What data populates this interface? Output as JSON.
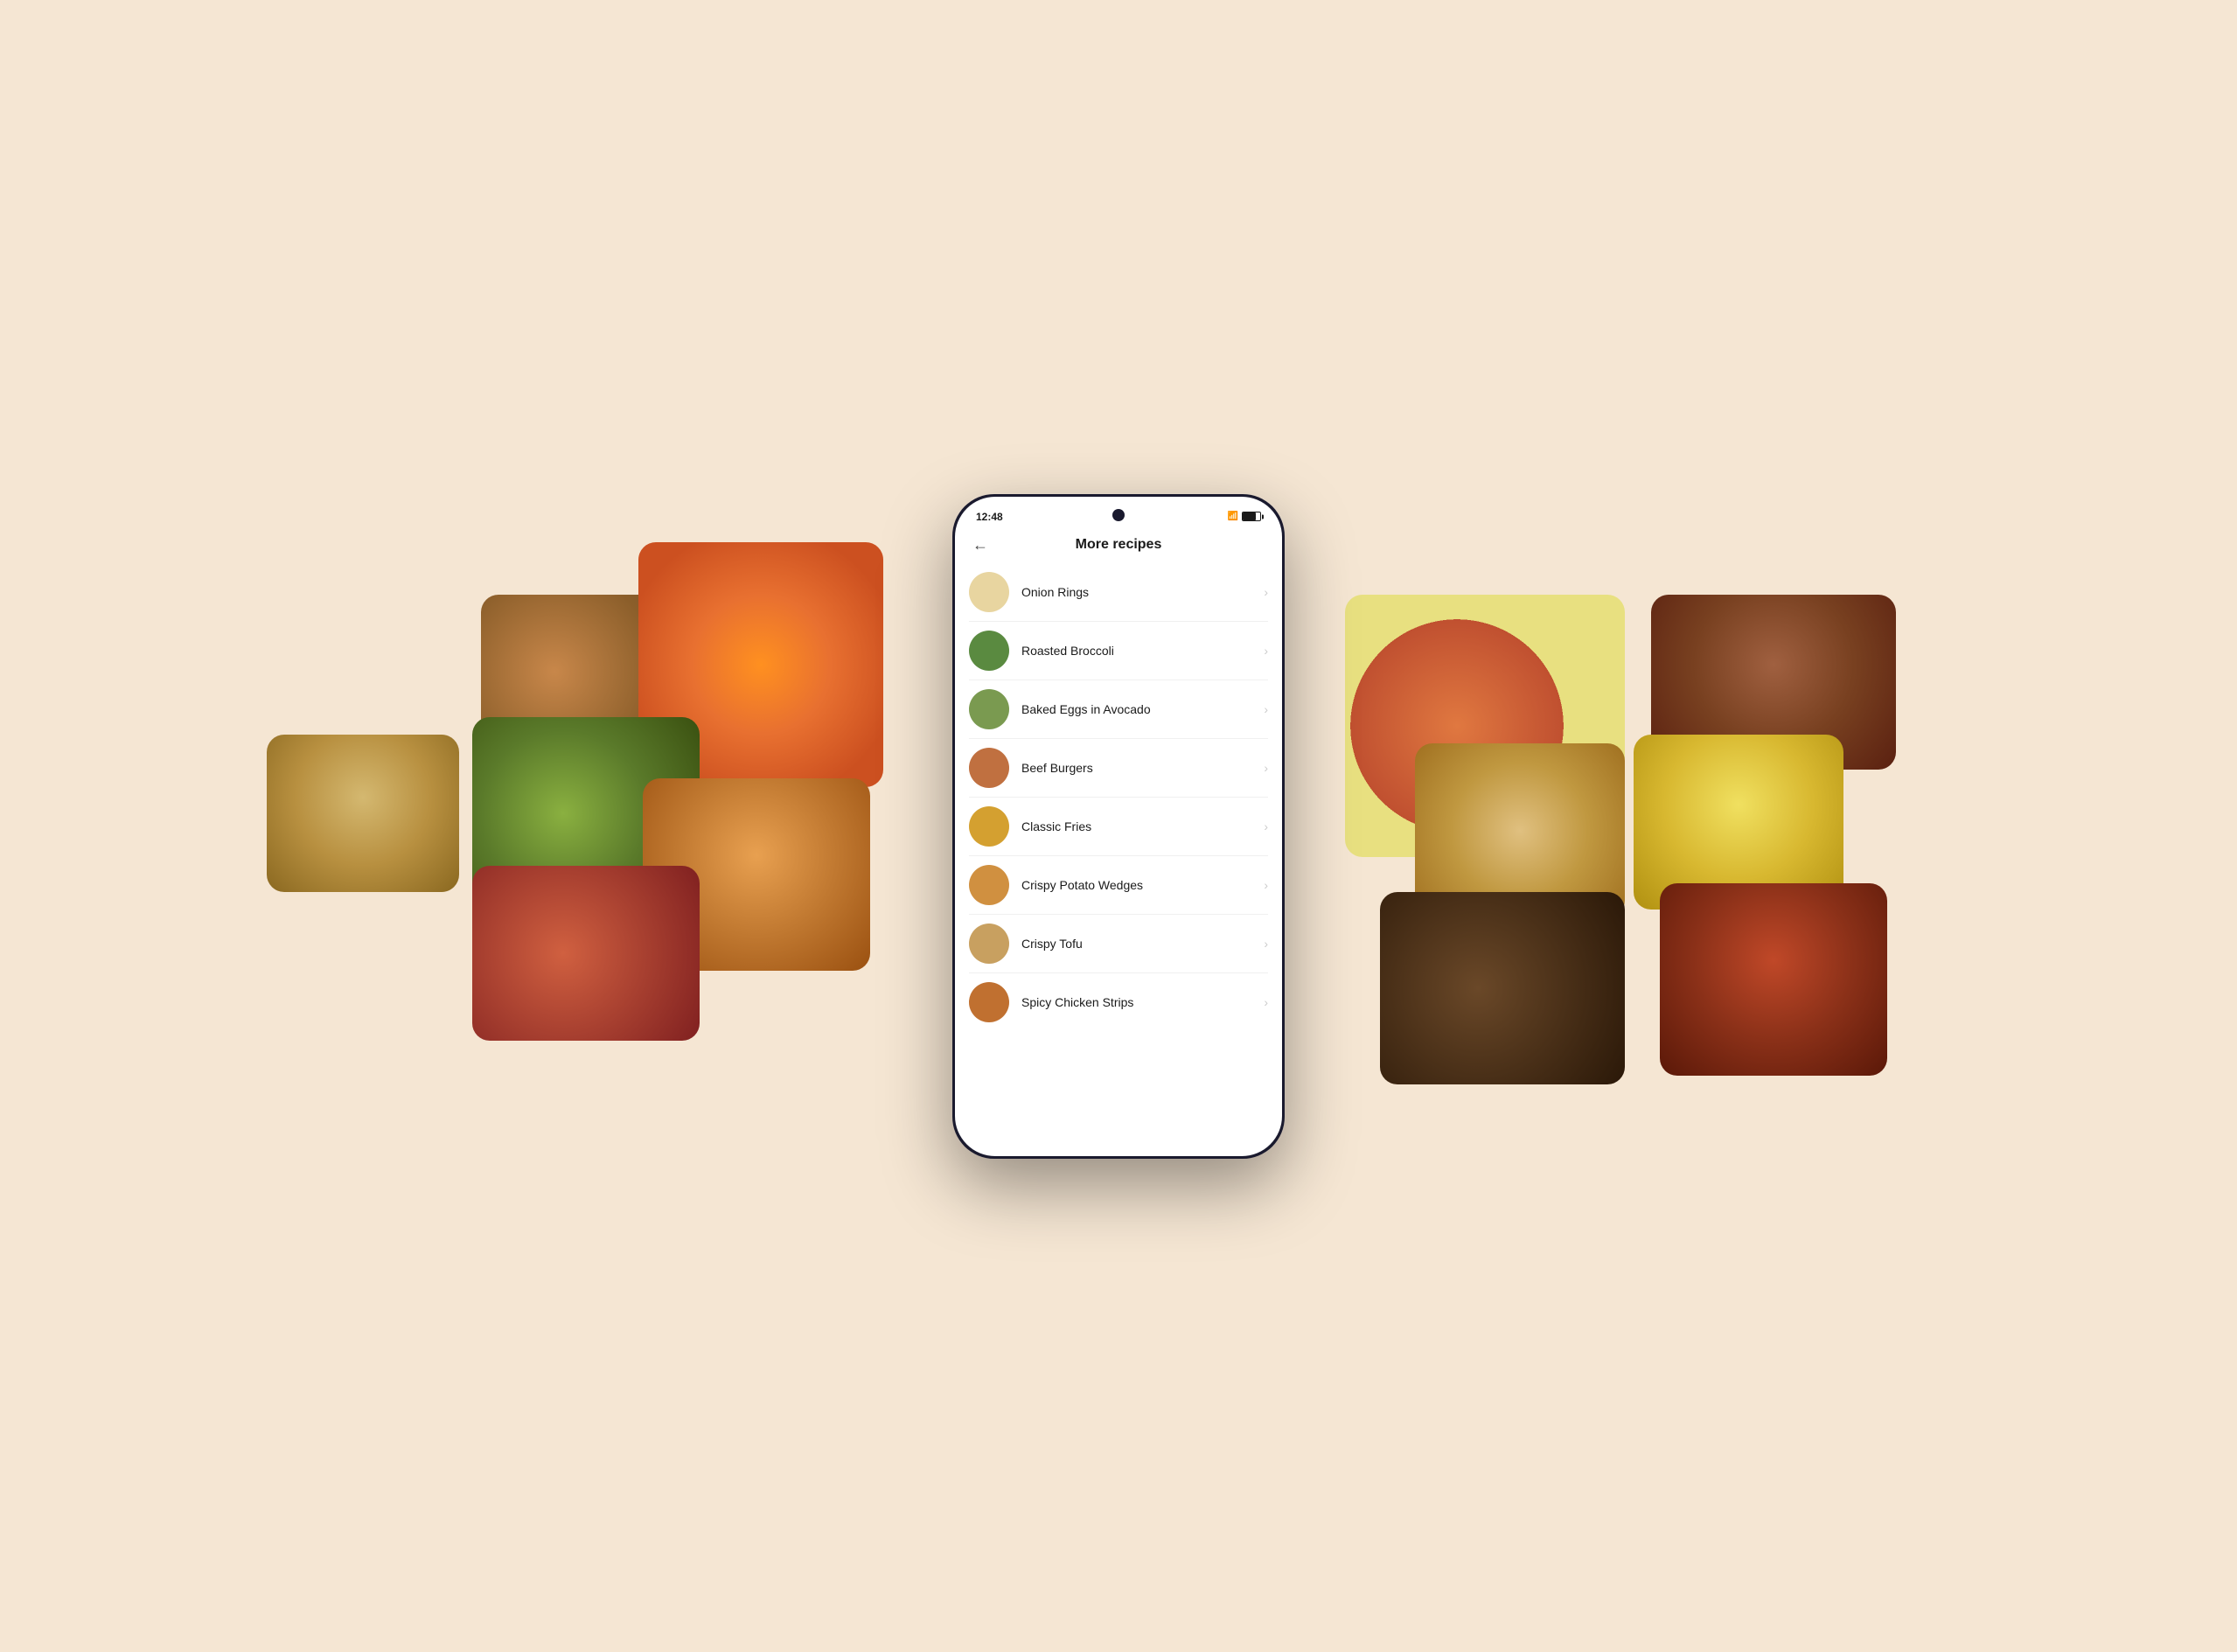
{
  "background": {
    "color": "#f5e6d3"
  },
  "status_bar": {
    "time": "12:48",
    "wifi_icon": "▾",
    "battery_level": "75"
  },
  "header": {
    "back_label": "←",
    "title": "More recipes"
  },
  "recipes": [
    {
      "id": "onion-rings",
      "name": "Onion Rings",
      "thumb_class": "thumb-onion"
    },
    {
      "id": "roasted-broccoli",
      "name": "Roasted Broccoli",
      "thumb_class": "thumb-broccoli"
    },
    {
      "id": "baked-eggs",
      "name": "Baked Eggs in Avocado",
      "thumb_class": "thumb-avocado"
    },
    {
      "id": "beef-burgers",
      "name": "Beef Burgers",
      "thumb_class": "thumb-burgers"
    },
    {
      "id": "classic-fries",
      "name": "Classic Fries",
      "thumb_class": "thumb-fries"
    },
    {
      "id": "crispy-potato-wedges",
      "name": "Crispy Potato Wedges",
      "thumb_class": "thumb-wedges"
    },
    {
      "id": "crispy-tofu",
      "name": "Crispy Tofu",
      "thumb_class": "thumb-tofu"
    },
    {
      "id": "spicy-chicken-strips",
      "name": "Spicy Chicken Strips",
      "thumb_class": "thumb-chicken"
    }
  ],
  "bg_images": {
    "left": [
      "tarts",
      "oranges",
      "avocado",
      "fried-food",
      "bruschetta",
      "cheesecake"
    ],
    "right": [
      "salmon",
      "steak",
      "cookies",
      "fries",
      "dessert",
      "stirfry"
    ]
  }
}
